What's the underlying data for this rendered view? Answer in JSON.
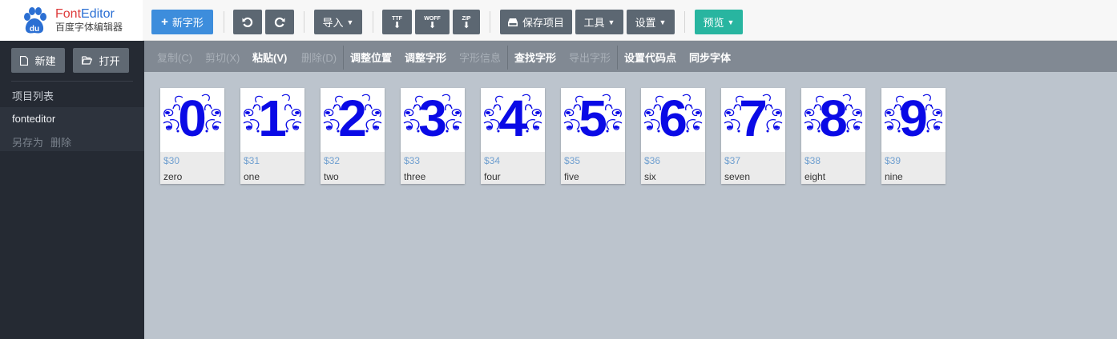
{
  "logo": {
    "title_font": "Font",
    "title_editor": "Editor",
    "subtitle": "百度字体编辑器"
  },
  "toolbar": {
    "new_glyph": "新字形",
    "undo_icon": "undo-icon",
    "redo_icon": "redo-icon",
    "import": "导入",
    "export_ttf": "TTF",
    "export_woff": "WOFF",
    "export_zip": "ZIP",
    "save_project": "保存项目",
    "tools": "工具",
    "settings": "设置",
    "preview": "预览"
  },
  "sidebar": {
    "new_btn": "新建",
    "open_btn": "打开",
    "project_list_title": "项目列表",
    "projects": [
      {
        "name": "fonteditor",
        "save_as": "另存为",
        "delete": "删除"
      }
    ]
  },
  "commands": [
    {
      "label": "复制(C)",
      "enabled": false
    },
    {
      "label": "剪切(X)",
      "enabled": false
    },
    {
      "label": "粘贴(V)",
      "enabled": true
    },
    {
      "label": "删除(D)",
      "enabled": false
    },
    {
      "label": "调整位置",
      "enabled": true
    },
    {
      "label": "调整字形",
      "enabled": true
    },
    {
      "label": "字形信息",
      "enabled": false
    },
    {
      "label": "查找字形",
      "enabled": true
    },
    {
      "label": "导出字形",
      "enabled": false
    },
    {
      "label": "设置代码点",
      "enabled": true
    },
    {
      "label": "同步字体",
      "enabled": true
    }
  ],
  "glyphs": [
    {
      "char": "0",
      "code": "$30",
      "name": "zero"
    },
    {
      "char": "1",
      "code": "$31",
      "name": "one"
    },
    {
      "char": "2",
      "code": "$32",
      "name": "two"
    },
    {
      "char": "3",
      "code": "$33",
      "name": "three"
    },
    {
      "char": "4",
      "code": "$34",
      "name": "four"
    },
    {
      "char": "5",
      "code": "$35",
      "name": "five"
    },
    {
      "char": "6",
      "code": "$36",
      "name": "six"
    },
    {
      "char": "7",
      "code": "$37",
      "name": "seven"
    },
    {
      "char": "8",
      "code": "$38",
      "name": "eight"
    },
    {
      "char": "9",
      "code": "$39",
      "name": "nine"
    }
  ],
  "colors": {
    "glyph": "#0a0ae6",
    "accent_blue": "#3d8ddc",
    "accent_teal": "#28b5a0",
    "sidebar_bg": "#252a33"
  }
}
